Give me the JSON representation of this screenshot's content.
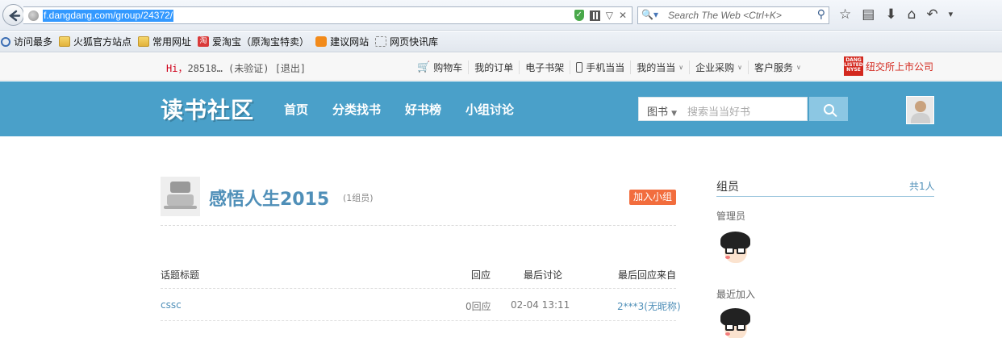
{
  "browser": {
    "url": "f.dangdang.com/group/24372/",
    "search_placeholder": "Search The Web <Ctrl+K>",
    "bookmarks": [
      "访问最多",
      "火狐官方站点",
      "常用网址",
      "爱淘宝（原淘宝特卖）",
      "建议网站",
      "网页快讯库"
    ]
  },
  "topbar": {
    "greeting_hi": "Hi，",
    "greeting_user": "28518… (未验证) [退出]",
    "links": [
      "购物车",
      "我的订单",
      "电子书架",
      "手机当当",
      "我的当当",
      "企业采购",
      "客户服务"
    ],
    "nyse_logo": "DANG LISTED NYSE",
    "nyse_text": "纽交所上市公司"
  },
  "header": {
    "logo": "读书社区",
    "nav": [
      "首页",
      "分类找书",
      "好书榜",
      "小组讨论"
    ],
    "search_category": "图书",
    "search_placeholder": "搜索当当好书"
  },
  "group": {
    "title": "感悟人生2015",
    "member_count": "(1组员)",
    "join_label": "加入小组",
    "columns": {
      "topic": "话题标题",
      "replies": "回应",
      "last_discussion": "最后讨论",
      "last_reply_from": "最后回应来自"
    },
    "rows": [
      {
        "topic": "cssc",
        "replies": "0回应",
        "last_discussion": "02-04 13:11",
        "last_reply_from": "2***3(无昵称)"
      }
    ]
  },
  "members": {
    "title": "组员",
    "total": "共1人",
    "admin_label": "管理员",
    "recent_label": "最近加入"
  }
}
